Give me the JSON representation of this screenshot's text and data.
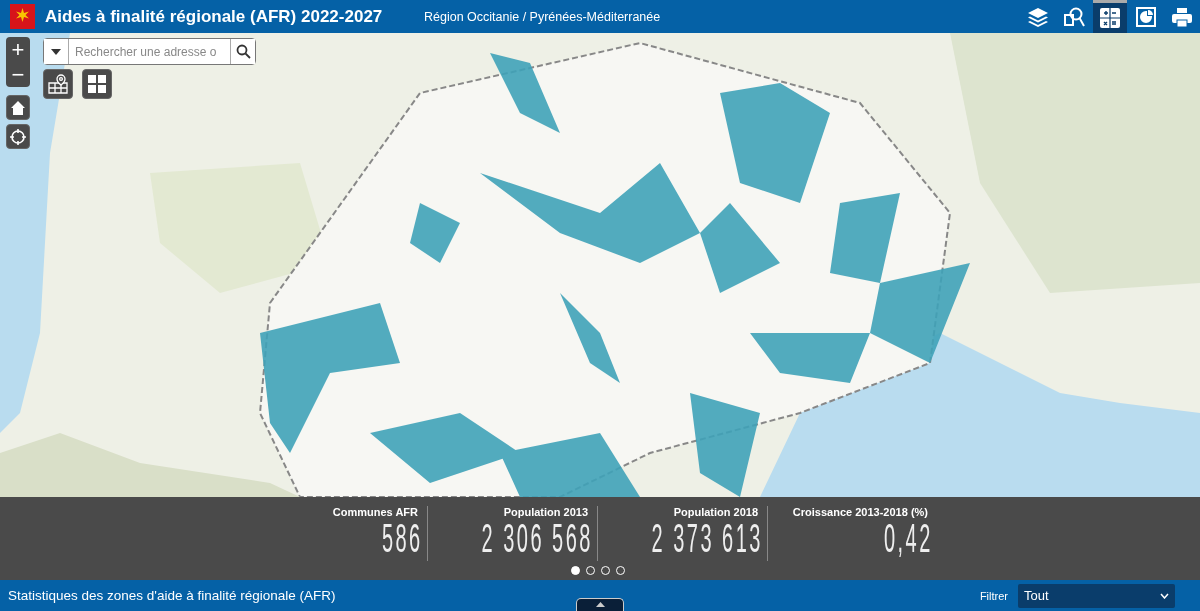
{
  "header": {
    "title": "Aides à finalité régionale (AFR) 2022-2027",
    "subtitle": "Région Occitanie / Pyrénées-Méditerranée"
  },
  "tools": [
    {
      "kind": "layers",
      "selected": false
    },
    {
      "kind": "query",
      "selected": false
    },
    {
      "kind": "calculator",
      "selected": true
    },
    {
      "kind": "chart",
      "selected": false
    },
    {
      "kind": "print",
      "selected": false
    }
  ],
  "map": {
    "kind": "picture",
    "zoom_in": "+",
    "zoom_out": "−",
    "search": {
      "placeholder": "Rechercher une adresse o"
    }
  },
  "stats": [
    {
      "label": "Communes AFR",
      "value": "586"
    },
    {
      "label": "Population 2013",
      "value": "2 306 568"
    },
    {
      "label": "Population 2018",
      "value": "2 373 613"
    },
    {
      "label": "Croissance 2013-2018 (%)",
      "value": "0,42"
    }
  ],
  "pager": [
    {
      "selected": true
    },
    {
      "selected": false
    },
    {
      "selected": false
    },
    {
      "selected": false
    }
  ],
  "footer": {
    "title": "Statistiques des zones d'aide à finalité régionale (AFR)",
    "filter_label": "Filtrer",
    "filter_value": "Tout"
  }
}
